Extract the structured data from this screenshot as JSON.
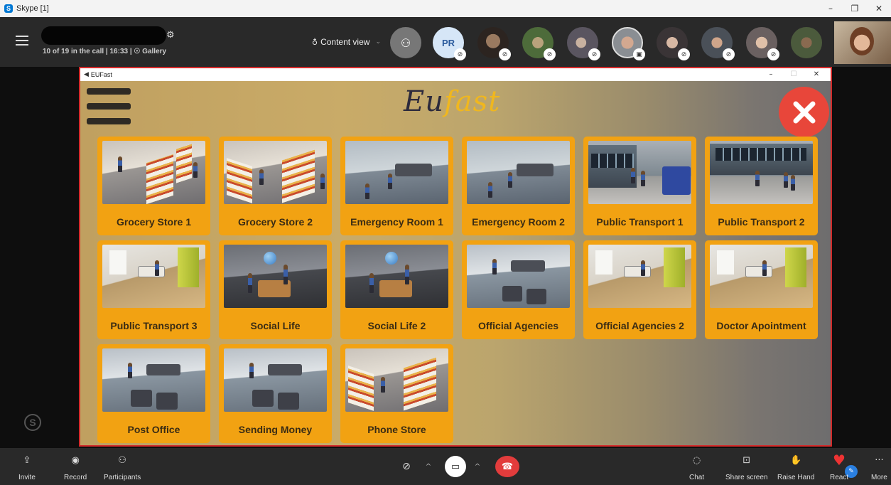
{
  "window": {
    "title": "Skype [1]"
  },
  "call": {
    "info": "10 of 19 in the call | 16:33 | ☉ Gallery",
    "content_view_label": "Content view",
    "participant_initials": "PR"
  },
  "app": {
    "window_title": "EUFast",
    "logo_part1": "Eu",
    "logo_part2": "fast",
    "tiles": [
      {
        "label": "Grocery Store 1"
      },
      {
        "label": "Grocery Store 2"
      },
      {
        "label": "Emergency Room 1"
      },
      {
        "label": "Emergency Room 2"
      },
      {
        "label": "Public Transport 1"
      },
      {
        "label": "Public Transport 2"
      },
      {
        "label": "Public Transport 3"
      },
      {
        "label": "Social Life"
      },
      {
        "label": "Social Life 2"
      },
      {
        "label": "Official Agencies"
      },
      {
        "label": "Official Agencies 2"
      },
      {
        "label": "Doctor Apointment"
      },
      {
        "label": "Post Office"
      },
      {
        "label": "Sending Money"
      },
      {
        "label": "Phone Store"
      }
    ]
  },
  "bottom_bar": {
    "invite": "Invite",
    "record": "Record",
    "participants": "Participants",
    "chat": "Chat",
    "share_screen": "Share screen",
    "raise_hand": "Raise Hand",
    "react": "React",
    "more": "More"
  },
  "colors": {
    "tile_bg": "#f2a212",
    "close_red": "#e8463a",
    "hangup_red": "#e23c3c",
    "logo_gold": "#f0b71e",
    "share_border": "#d42a2a"
  }
}
